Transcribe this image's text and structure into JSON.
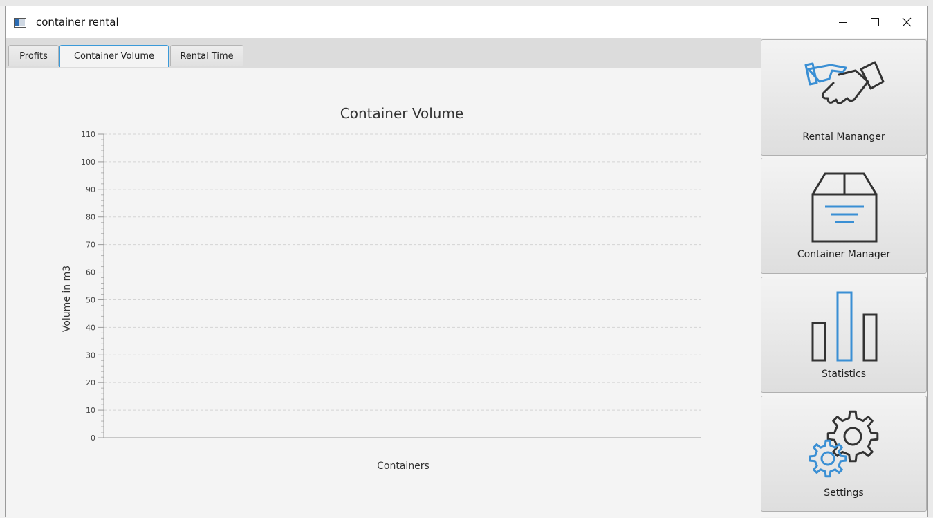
{
  "window": {
    "title": "container rental"
  },
  "tabs": [
    {
      "label": "Profits",
      "active": false
    },
    {
      "label": "Container Volume",
      "active": true
    },
    {
      "label": "Rental Time",
      "active": false
    }
  ],
  "sidebar": {
    "items": [
      {
        "label": "Rental Mananger",
        "icon": "handshake-icon"
      },
      {
        "label": "Container Manager",
        "icon": "box-icon"
      },
      {
        "label": "Statistics",
        "icon": "bar-chart-icon"
      },
      {
        "label": "Settings",
        "icon": "gears-icon"
      }
    ]
  },
  "colors": {
    "accent": "#3a8fd4",
    "icon_dark": "#333333",
    "tab_focus": "#3b9ad9"
  },
  "chart_data": {
    "type": "bar",
    "title": "Container Volume",
    "xlabel": "Containers",
    "ylabel": "Volume in m3",
    "ylim": [
      0,
      110
    ],
    "yticks": [
      0,
      10,
      20,
      30,
      40,
      50,
      60,
      70,
      80,
      90,
      100,
      110
    ],
    "categories": [],
    "values": [],
    "grid": true,
    "legend": "none"
  }
}
